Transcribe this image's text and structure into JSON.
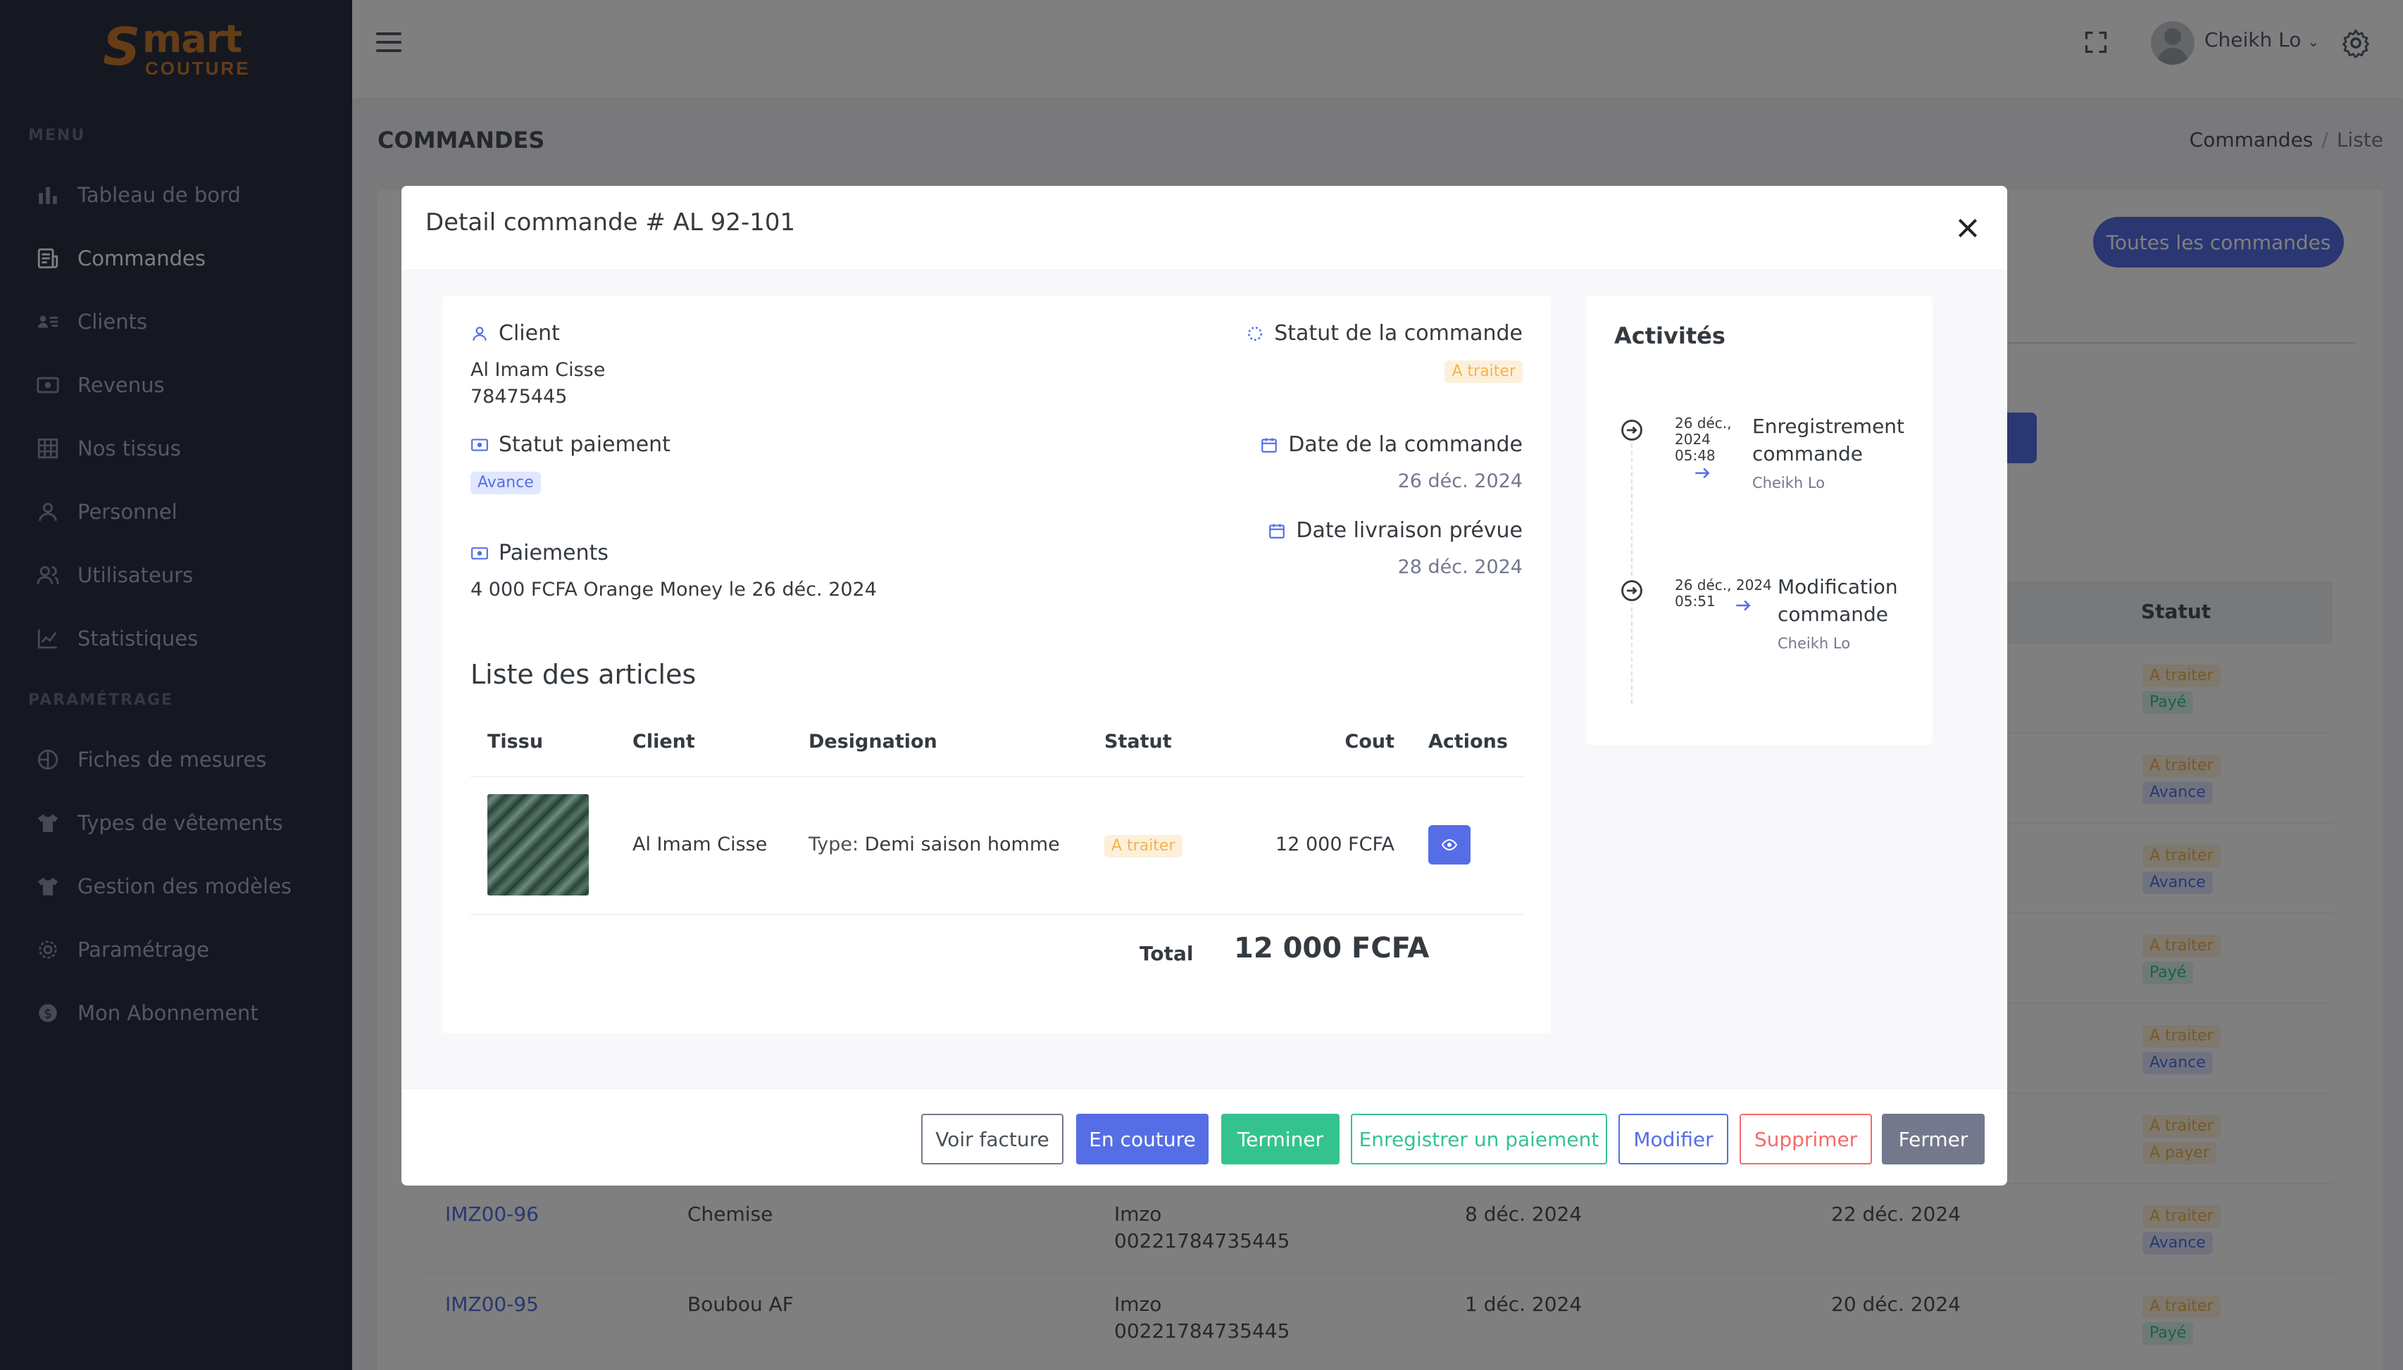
{
  "app": {
    "logo_text_s": "S",
    "logo_text_mart": "mart",
    "logo_text_couture": "COUTURE",
    "brand_color": "#c87a2e"
  },
  "sidebar": {
    "menu_title": "MENU",
    "settings_title": "PARAMÉTRAGE",
    "items": [
      {
        "label": "Tableau de bord",
        "icon": "bar-chart-icon"
      },
      {
        "label": "Commandes",
        "icon": "receipt-icon",
        "active": true
      },
      {
        "label": "Clients",
        "icon": "user-list-icon"
      },
      {
        "label": "Revenus",
        "icon": "money-icon"
      },
      {
        "label": "Nos tissus",
        "icon": "grid-icon"
      },
      {
        "label": "Personnel",
        "icon": "user-icon"
      },
      {
        "label": "Utilisateurs",
        "icon": "users-icon"
      },
      {
        "label": "Statistiques",
        "icon": "line-chart-icon"
      }
    ],
    "settings_items": [
      {
        "label": "Fiches de mesures",
        "icon": "measure-icon"
      },
      {
        "label": "Types de vêtements",
        "icon": "shirt-icon"
      },
      {
        "label": "Gestion des modèles",
        "icon": "shirt-icon"
      },
      {
        "label": "Paramétrage",
        "icon": "gear-icon"
      },
      {
        "label": "Mon Abonnement",
        "icon": "dollar-icon"
      }
    ]
  },
  "topbar": {
    "user_name": "Cheikh Lo"
  },
  "page": {
    "title": "COMMANDES",
    "breadcrumb": [
      "Commandes",
      "Liste"
    ],
    "all_orders_button": "Toutes les commandes",
    "status_column": "Statut"
  },
  "background_rows": [
    {
      "badges": [
        {
          "text": "A traiter",
          "kind": "warn"
        },
        {
          "text": "Payé",
          "kind": "ok"
        }
      ]
    },
    {
      "badges": [
        {
          "text": "A traiter",
          "kind": "warn"
        },
        {
          "text": "Avance",
          "kind": "info"
        }
      ]
    },
    {
      "badges": [
        {
          "text": "A traiter",
          "kind": "warn"
        },
        {
          "text": "Avance",
          "kind": "info"
        }
      ]
    },
    {
      "badges": [
        {
          "text": "A traiter",
          "kind": "warn"
        },
        {
          "text": "Payé",
          "kind": "ok"
        }
      ]
    },
    {
      "badges": [
        {
          "text": "A traiter",
          "kind": "warn"
        },
        {
          "text": "Avance",
          "kind": "info"
        }
      ]
    },
    {
      "badges": [
        {
          "text": "A traiter",
          "kind": "warn"
        },
        {
          "text": "A payer",
          "kind": "warn"
        }
      ]
    },
    {
      "ref": "IMZ00-96",
      "designation": "Chemise",
      "client": "Imzo",
      "phone": "00221784735445",
      "date": "8 déc. 2024",
      "delivery": "22 déc. 2024",
      "badges": [
        {
          "text": "A traiter",
          "kind": "warn"
        },
        {
          "text": "Avance",
          "kind": "info"
        }
      ]
    },
    {
      "ref": "IMZ00-95",
      "designation": "Boubou AF",
      "client": "Imzo",
      "phone": "00221784735445",
      "date": "1 déc. 2024",
      "delivery": "20 déc. 2024",
      "badges": [
        {
          "text": "A traiter",
          "kind": "warn"
        },
        {
          "text": "Payé",
          "kind": "ok"
        }
      ]
    }
  ],
  "modal": {
    "title": "Detail commande # AL 92-101",
    "client": {
      "label": "Client",
      "name": "Al Imam Cisse",
      "phone": "78475445"
    },
    "order_status": {
      "label": "Statut de la commande",
      "value": "A traiter"
    },
    "payment_status": {
      "label": "Statut paiement",
      "value": "Avance"
    },
    "order_date": {
      "label": "Date de la commande",
      "value": "26 déc. 2024"
    },
    "delivery_date": {
      "label": "Date livraison prévue",
      "value": "28 déc. 2024"
    },
    "payments": {
      "label": "Paiements",
      "value": "4 000 FCFA Orange Money le 26 déc. 2024"
    },
    "articles": {
      "title": "Liste des articles",
      "columns": [
        "Tissu",
        "Client",
        "Designation",
        "Statut",
        "Cout",
        "Actions"
      ],
      "rows": [
        {
          "client": "Al Imam Cisse",
          "type_prefix": "Type:",
          "designation": "Demi saison homme",
          "status": "A traiter",
          "cost": "12 000 FCFA"
        }
      ],
      "total_label": "Total",
      "total_value": "12 000 FCFA"
    },
    "activities": {
      "title": "Activités",
      "items": [
        {
          "date_line1": "26 déc.,",
          "date_line2": "2024",
          "time": "05:48",
          "title_line1": "Enregistrement",
          "title_line2": "commande",
          "by": "Cheikh Lo"
        },
        {
          "date_line1": "26 déc., 2024",
          "time": "05:51",
          "title_line1": "Modification",
          "title_line2": "commande",
          "by": "Cheikh Lo"
        }
      ]
    },
    "buttons": {
      "invoice": "Voir facture",
      "sewing": "En couture",
      "finish": "Terminer",
      "payment": "Enregistrer un paiement",
      "edit": "Modifier",
      "delete": "Supprimer",
      "close": "Fermer"
    }
  },
  "colors": {
    "primary": "#556ee6",
    "success": "#34c38f",
    "danger": "#f46a6a",
    "warning": "#f1b44c",
    "secondary": "#74788d",
    "sidebar": "#2a3042"
  }
}
